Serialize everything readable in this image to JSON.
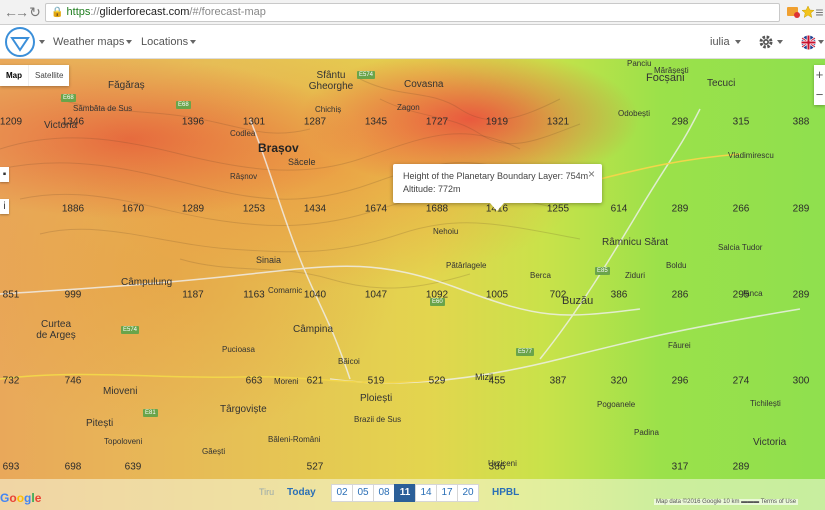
{
  "browser": {
    "url_scheme": "https",
    "url_host": "gliderforecast.com",
    "url_path": "/#/forecast-map"
  },
  "header": {
    "menu_weather_maps": "Weather maps",
    "menu_locations": "Locations",
    "user_name": "iulia",
    "settings_icon": "gear-icon",
    "language_icon": "uk-flag-icon"
  },
  "map_controls": {
    "map_type_map": "Map",
    "map_type_satellite": "Satellite",
    "zoom_in": "+",
    "zoom_out": "−"
  },
  "popup": {
    "line1": "Height of the Planetary Boundary Layer: 754m",
    "line2": "Altitude: 772m",
    "close": "×"
  },
  "places": [
    {
      "name": "Făgăraș"
    },
    {
      "name": "Sâmbăta de Sus"
    },
    {
      "name": "Victoria"
    },
    {
      "name": "Sfântu Gheorghe"
    },
    {
      "name": "Chichiș"
    },
    {
      "name": "Covasna"
    },
    {
      "name": "Zagon"
    },
    {
      "name": "Brașov"
    },
    {
      "name": "Săcele"
    },
    {
      "name": "Codlea"
    },
    {
      "name": "Râșnov"
    },
    {
      "name": "Sinaia"
    },
    {
      "name": "Câmpulung"
    },
    {
      "name": "Comarnic"
    },
    {
      "name": "Curtea de Argeș"
    },
    {
      "name": "Câmpina"
    },
    {
      "name": "Băicoi"
    },
    {
      "name": "Pucioasa"
    },
    {
      "name": "Mioveni"
    },
    {
      "name": "Moreni"
    },
    {
      "name": "Târgoviște"
    },
    {
      "name": "Pitești"
    },
    {
      "name": "Topoloveni"
    },
    {
      "name": "Găești"
    },
    {
      "name": "Ploiești"
    },
    {
      "name": "Brazii de Sus"
    },
    {
      "name": "Băleni-Români"
    },
    {
      "name": "Mizil"
    },
    {
      "name": "Urziceni"
    },
    {
      "name": "Buzău"
    },
    {
      "name": "Pătârlagele"
    },
    {
      "name": "Berca"
    },
    {
      "name": "Nehoiu"
    },
    {
      "name": "Focșani"
    },
    {
      "name": "Odobești"
    },
    {
      "name": "Mărășești"
    },
    {
      "name": "Tecuci"
    },
    {
      "name": "Panciu"
    },
    {
      "name": "Râmnicu Sărat"
    },
    {
      "name": "Vladimirescu"
    },
    {
      "name": "Salcia Tudor"
    },
    {
      "name": "Boldu"
    },
    {
      "name": "Ziduri"
    },
    {
      "name": "Făurei"
    },
    {
      "name": "Pogoanele"
    },
    {
      "name": "Padina"
    },
    {
      "name": "Victoria"
    },
    {
      "name": "Ianca"
    },
    {
      "name": "Tichilești"
    }
  ],
  "grid_values": [
    {
      "v": "1209"
    },
    {
      "v": "1346"
    },
    {
      "v": "1396"
    },
    {
      "v": "1301"
    },
    {
      "v": "1287"
    },
    {
      "v": "1345"
    },
    {
      "v": "1727"
    },
    {
      "v": "1919"
    },
    {
      "v": "1321"
    },
    {
      "v": "298"
    },
    {
      "v": "315"
    },
    {
      "v": "388"
    },
    {
      "v": "1886"
    },
    {
      "v": "1670"
    },
    {
      "v": "1289"
    },
    {
      "v": "1253"
    },
    {
      "v": "1434"
    },
    {
      "v": "1674"
    },
    {
      "v": "1688"
    },
    {
      "v": "1416"
    },
    {
      "v": "1255"
    },
    {
      "v": "614"
    },
    {
      "v": "289"
    },
    {
      "v": "266"
    },
    {
      "v": "289"
    },
    {
      "v": "851"
    },
    {
      "v": "999"
    },
    {
      "v": "1187"
    },
    {
      "v": "1163"
    },
    {
      "v": "1040"
    },
    {
      "v": "1047"
    },
    {
      "v": "1092"
    },
    {
      "v": "1005"
    },
    {
      "v": "702"
    },
    {
      "v": "386"
    },
    {
      "v": "286"
    },
    {
      "v": "295"
    },
    {
      "v": "289"
    },
    {
      "v": "732"
    },
    {
      "v": "746"
    },
    {
      "v": "663"
    },
    {
      "v": "621"
    },
    {
      "v": "519"
    },
    {
      "v": "529"
    },
    {
      "v": "455"
    },
    {
      "v": "387"
    },
    {
      "v": "320"
    },
    {
      "v": "296"
    },
    {
      "v": "274"
    },
    {
      "v": "300"
    },
    {
      "v": "693"
    },
    {
      "v": "698"
    },
    {
      "v": "639"
    },
    {
      "v": "527"
    },
    {
      "v": "386"
    },
    {
      "v": "317"
    },
    {
      "v": "289"
    }
  ],
  "timeline": {
    "faded_label": "Tiru",
    "today": "Today",
    "hours": [
      "02",
      "05",
      "08",
      "11",
      "14",
      "17",
      "20"
    ],
    "active_hour": "11",
    "hpbl": "HPBL"
  },
  "attribution": "Map data ©2016 Google   10 km ▬▬▬   Terms of Use",
  "google_logo": "Google"
}
